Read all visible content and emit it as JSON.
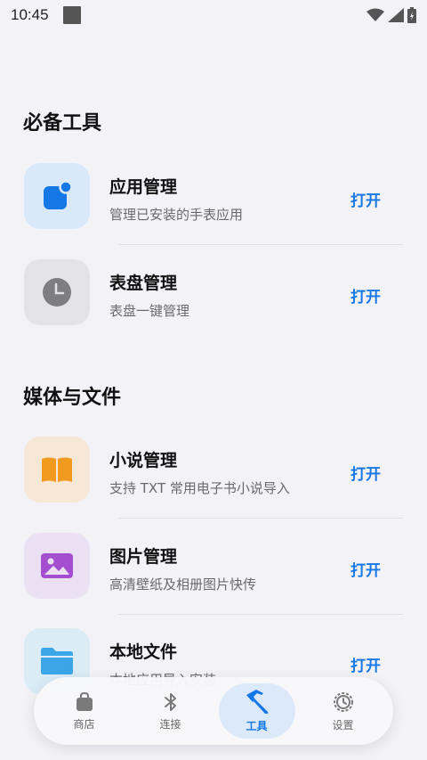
{
  "status_bar": {
    "time": "10:45"
  },
  "sections": [
    {
      "title": "必备工具",
      "items": [
        {
          "title": "应用管理",
          "subtitle": "管理已安装的手表应用",
          "action": "打开"
        },
        {
          "title": "表盘管理",
          "subtitle": "表盘一键管理",
          "action": "打开"
        }
      ]
    },
    {
      "title": "媒体与文件",
      "items": [
        {
          "title": "小说管理",
          "subtitle": "支持 TXT 常用电子书小说导入",
          "action": "打开"
        },
        {
          "title": "图片管理",
          "subtitle": "高清壁纸及相册图片快传",
          "action": "打开"
        },
        {
          "title": "本地文件",
          "subtitle": "本地应用导入安装",
          "action": "打开"
        }
      ]
    }
  ],
  "bottom_nav": [
    {
      "label": "商店",
      "icon": "shopping-bag-icon"
    },
    {
      "label": "连接",
      "icon": "bluetooth-icon"
    },
    {
      "label": "工具",
      "icon": "hammer-icon",
      "active": true
    },
    {
      "label": "设置",
      "icon": "gear-icon"
    }
  ],
  "colors": {
    "accent": "#1677e6",
    "background": "#f3f2f7"
  }
}
